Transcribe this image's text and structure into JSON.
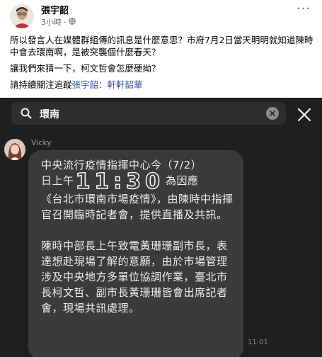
{
  "post": {
    "author": "張宇韶",
    "time": "3小時",
    "privacy_icon": "globe-icon",
    "para1": "所以發言人在媒體群組傳的訊息是什麼意思？市府7月2日當天明明就知道陳時中會去環南啊，是被突襲個什麼春天？",
    "para2": "讓我們來猜一下，柯文哲會怎麼硬拗？",
    "para3_prefix": "請持續關注追蹤",
    "para3_tag": "張宇韶：軒軒韶華"
  },
  "screenshot": {
    "search_query": "環南",
    "sender": "Vicky",
    "message_line1": "中央流行疫情指揮中心今（7/2）",
    "message_prefix": "日上午",
    "big_time": "11:30",
    "message_suffix": "為因應",
    "message_rest": "《台北市環南市場疫情》，由陳時中指揮官召開臨時記者會，提供直播及共訊。",
    "message_para2": "陳時中部長上午致電黃珊珊副市長，表達想赴現場了解的意願，由於市場管理涉及中央地方多單位協調作業，臺北市長柯文哲、副市長黃珊珊皆會出席記者會，現場共訊處理。",
    "timestamp": "11:01"
  },
  "colors": {
    "link": "#385898",
    "dark_bg": "#1f1f1f",
    "bubble": "#3a3a3a"
  }
}
